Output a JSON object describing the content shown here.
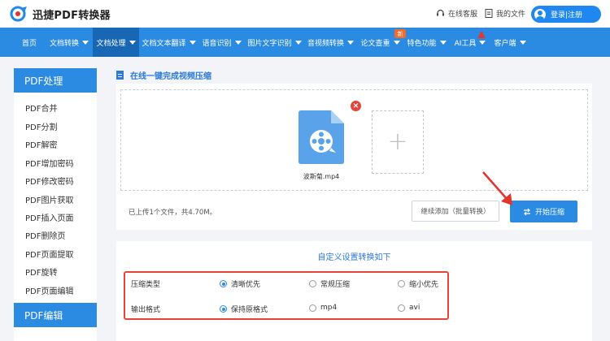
{
  "header": {
    "app_name": "迅捷PDF转换器",
    "online_service": "在线客服",
    "my_files": "我的文件",
    "login": "登录|注册"
  },
  "nav": {
    "items": [
      {
        "label": "首页"
      },
      {
        "label": "文档转换"
      },
      {
        "label": "文档处理"
      },
      {
        "label": "文档文本翻译"
      },
      {
        "label": "语音识别"
      },
      {
        "label": "图片文字识别"
      },
      {
        "label": "音视频转换"
      },
      {
        "label": "论文查重"
      },
      {
        "label": "特色功能"
      },
      {
        "label": "AI工具"
      },
      {
        "label": "客户端"
      }
    ],
    "new_badge": "新",
    "active_index": 2
  },
  "sidebar": {
    "section1": "PDF处理",
    "items": [
      "PDF合并",
      "PDF分割",
      "PDF解密",
      "PDF增加密码",
      "PDF修改密码",
      "PDF图片获取",
      "PDF插入页面",
      "PDF删除页",
      "PDF页面提取",
      "PDF旋转",
      "PDF页面编辑"
    ],
    "section2": "PDF编辑"
  },
  "main": {
    "title": "在线一键完成视频压缩",
    "file_name": "波斯菊.mp4",
    "remove_icon": "×",
    "add_icon": "+",
    "upload_info": "已上传1个文件，共4.70M。",
    "batch_button": "继续添加（批量转换）",
    "start_button": "开始压缩"
  },
  "settings": {
    "title": "自定义设置转换如下",
    "compress_label": "压缩类型",
    "compress_options": [
      "清晰优先",
      "常规压缩",
      "缩小优先"
    ],
    "compress_selected": 0,
    "output_label": "输出格式",
    "output_options": [
      "保持原格式",
      "mp4",
      "avi"
    ],
    "output_selected": 0
  },
  "colors": {
    "brand_blue": "#2b8ae2",
    "nav_active": "#1767b5",
    "highlight_red": "#e5443a"
  }
}
